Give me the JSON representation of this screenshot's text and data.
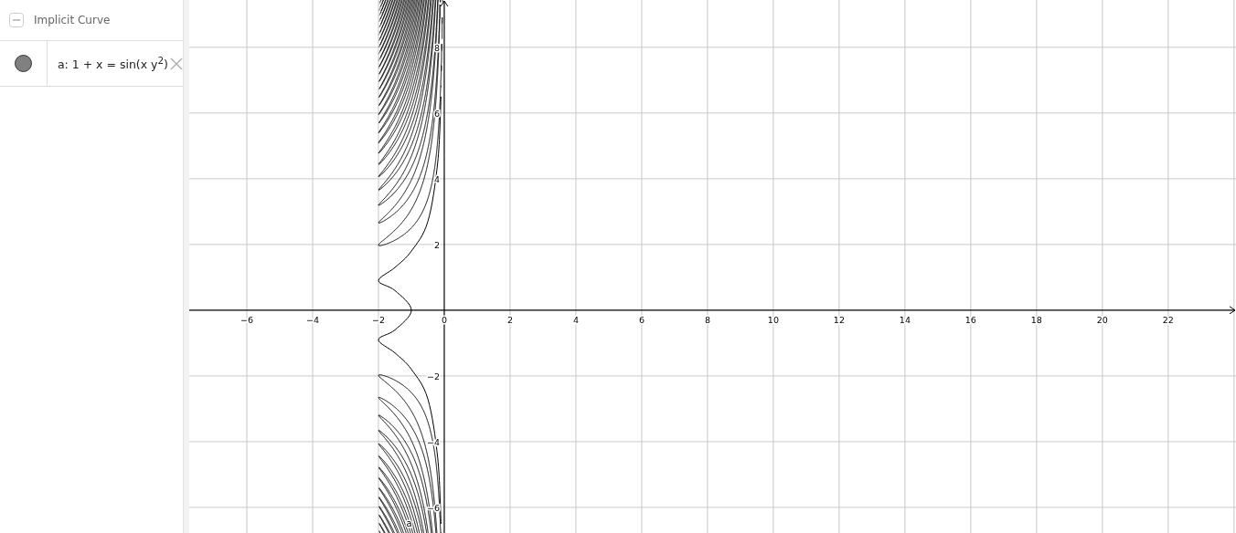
{
  "algebra_view": {
    "header": {
      "title": "Implicit Curve",
      "expanded": true
    },
    "items": [
      {
        "definition": "a: 1 + x = sin(x y$^{2}$)",
        "visible": true,
        "color": "#808080"
      }
    ]
  },
  "graphics_view": {
    "chart_data": {
      "type": "line",
      "grid": true,
      "xlim": [
        -7.75,
        24.06
      ],
      "ylim": [
        -6.78,
        9.44
      ],
      "xticks": [
        {
          "value": -6,
          "label": "−6"
        },
        {
          "value": -4,
          "label": "−4"
        },
        {
          "value": -2,
          "label": "−2"
        },
        {
          "value": 0,
          "label": "0"
        },
        {
          "value": 2,
          "label": "2"
        },
        {
          "value": 4,
          "label": "4"
        },
        {
          "value": 6,
          "label": "6"
        },
        {
          "value": 8,
          "label": "8"
        },
        {
          "value": 10,
          "label": "10"
        },
        {
          "value": 12,
          "label": "12"
        },
        {
          "value": 14,
          "label": "14"
        },
        {
          "value": 16,
          "label": "16"
        },
        {
          "value": 18,
          "label": "18"
        },
        {
          "value": 20,
          "label": "20"
        },
        {
          "value": 22,
          "label": "22"
        }
      ],
      "yticks": [
        {
          "value": -6,
          "label": "−6"
        },
        {
          "value": -4,
          "label": "−4"
        },
        {
          "value": -2,
          "label": "−2"
        },
        {
          "value": 2,
          "label": "2"
        },
        {
          "value": 4,
          "label": "4"
        },
        {
          "value": 6,
          "label": "6"
        },
        {
          "value": 8,
          "label": "8"
        }
      ],
      "series": [
        {
          "name": "a",
          "color": "#000000",
          "x": [
            -0.1,
            -0.2,
            -0.5,
            -1,
            -1.5,
            -2,
            -1.5,
            -1,
            -1.5,
            -2,
            -1.5,
            -1,
            -0.5,
            -0.2,
            -0.1
          ],
          "values": [
            6.5,
            4.5,
            2.7,
            1.8,
            1.3,
            0.9,
            0.6,
            0,
            -0.6,
            -0.9,
            -1.3,
            -1.8,
            -2.7,
            -4.5,
            -6.5
          ]
        }
      ]
    }
  }
}
